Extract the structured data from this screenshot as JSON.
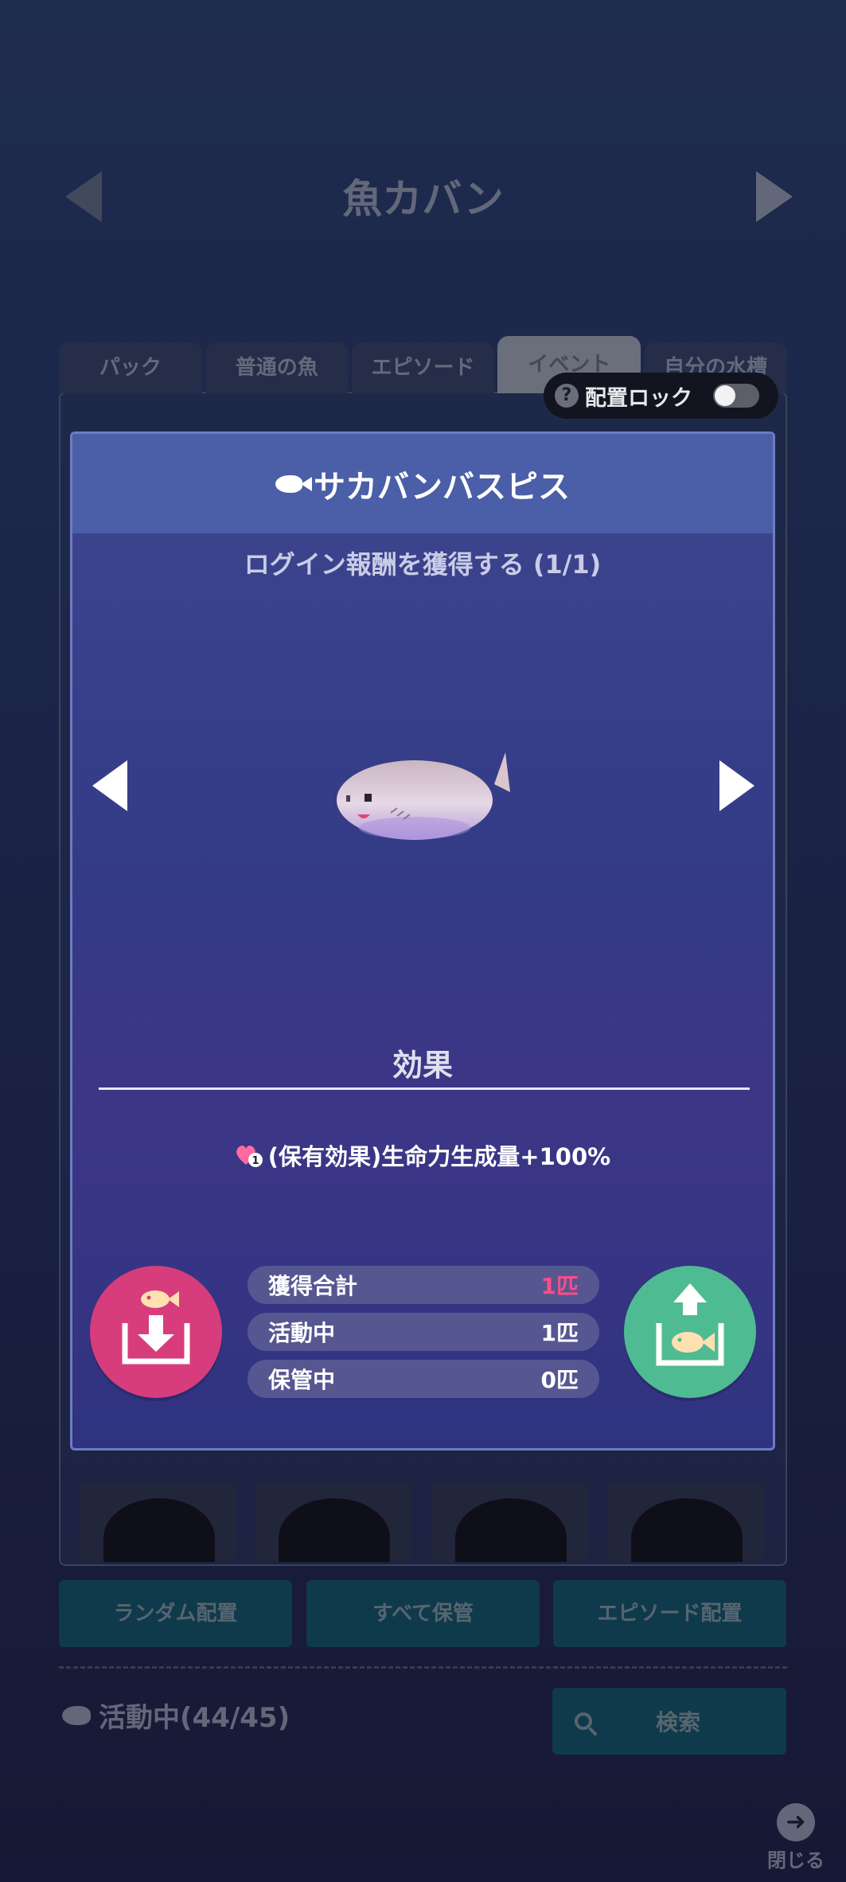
{
  "screen_title": "魚カバン",
  "tabs": [
    "パック",
    "普通の魚",
    "エピソード",
    "イベント",
    "自分の水槽"
  ],
  "lock": {
    "help": "?",
    "label": "配置ロック"
  },
  "bottom_buttons": {
    "random": "ランダム配置",
    "store_all": "すべて保管",
    "episode": "エピソード配置"
  },
  "active_count": "活動中(44/45)",
  "search_label": "検索",
  "close_label": "閉じる",
  "modal": {
    "title": "サカバンバスピス",
    "subtitle": "ログイン報酬を獲得する (1/1)",
    "effect_heading": "効果",
    "effect_text": "(保有効果)生命力生成量+100%",
    "effect_badge": "1",
    "stats": [
      {
        "label": "獲得合計",
        "value": "1匹"
      },
      {
        "label": "活動中",
        "value": "1匹"
      },
      {
        "label": "保管中",
        "value": "0匹"
      }
    ]
  },
  "colors": {
    "accent_pink": "#d73d7c",
    "accent_green": "#4fbb93",
    "total_value": "#ff4d86"
  }
}
